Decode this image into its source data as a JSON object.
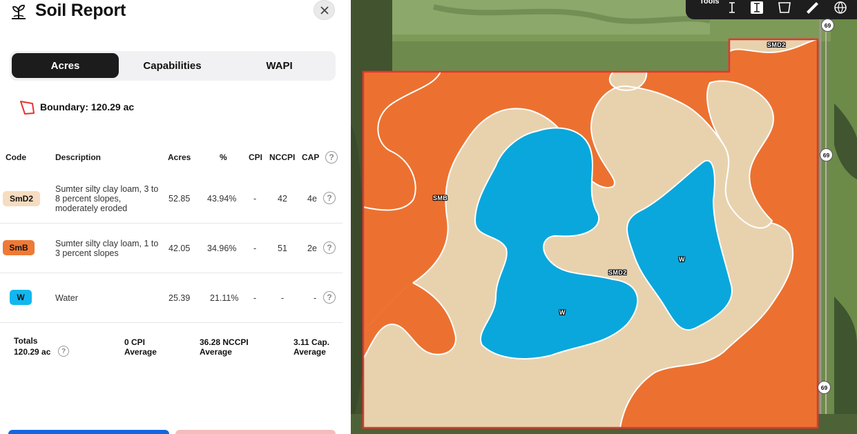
{
  "header": {
    "title": "Soil Report",
    "close_icon": "close-icon"
  },
  "tabs": [
    {
      "label": "Acres",
      "active": true
    },
    {
      "label": "Capabilities",
      "active": false
    },
    {
      "label": "WAPI",
      "active": false
    }
  ],
  "boundary": {
    "label": "Boundary: 120.29 ac"
  },
  "table": {
    "headers": {
      "code": "Code",
      "description": "Description",
      "acres": "Acres",
      "percent": "%",
      "cpi": "CPI",
      "nccpi": "NCCPI",
      "cap": "CAP"
    },
    "rows": [
      {
        "code": "SmD2",
        "color": "#f6dcc0",
        "description": "Sumter silty clay loam, 3 to 8 percent slopes, moderately eroded",
        "acres": "52.85",
        "percent": "43.94%",
        "cpi": "-",
        "nccpi": "42",
        "cap": "4e"
      },
      {
        "code": "SmB",
        "color": "#ee7a36",
        "description": "Sumter silty clay loam, 1 to 3 percent slopes",
        "acres": "42.05",
        "percent": "34.96%",
        "cpi": "-",
        "nccpi": "51",
        "cap": "2e"
      },
      {
        "code": "W",
        "color": "#12b7ef",
        "description": "Water",
        "acres": "25.39",
        "percent": "21.11%",
        "cpi": "-",
        "nccpi": "-",
        "cap": "-"
      }
    ]
  },
  "totals": {
    "label_line1": "Totals",
    "label_line2": "120.29 ac",
    "cpi_line1": "0 CPI",
    "cpi_line2": "Average",
    "nccpi_line1": "36.28 NCCPI",
    "nccpi_line2": "Average",
    "cap_line1": "3.11 Cap.",
    "cap_line2": "Average"
  },
  "map": {
    "toolbar_label": "Tools",
    "highway_shields": [
      "69",
      "69",
      "69"
    ],
    "labels": {
      "smd2_top": "SMD2",
      "smb": "SMB",
      "smd2_mid": "SMD2",
      "w_right": "W",
      "w_left": "W"
    },
    "colors": {
      "smd2": "#e8d2ae",
      "smb": "#ec7130",
      "water": "#0aa7dc",
      "boundary": "#e8332f"
    }
  }
}
